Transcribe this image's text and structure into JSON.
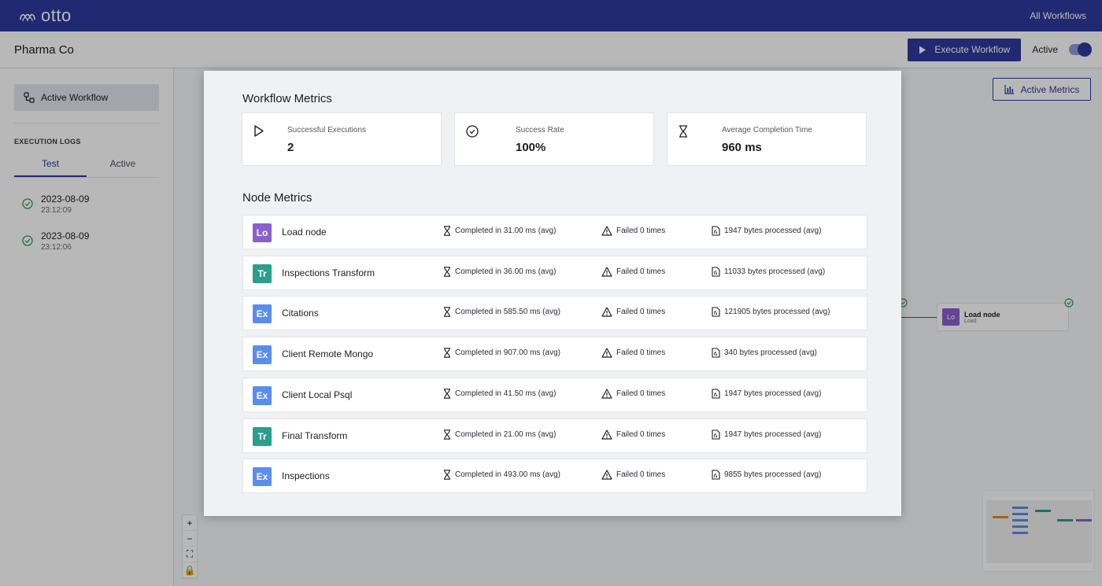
{
  "app": {
    "brand": "otto",
    "all_workflows_link": "All Workflows"
  },
  "header": {
    "org_name": "Pharma Co",
    "execute_button": "Execute Workflow",
    "active_label": "Active",
    "active_toggle_on": true
  },
  "sidebar": {
    "active_workflow": "Active Workflow",
    "logs_title": "EXECUTION LOGS",
    "tabs": [
      "Test",
      "Active"
    ],
    "selected_tab": "Test",
    "logs": [
      {
        "date": "2023-08-09",
        "time": "23:12:09"
      },
      {
        "date": "2023-08-09",
        "time": "23:12:06"
      }
    ]
  },
  "canvas": {
    "metrics_button": "Active Metrics",
    "visible_node": {
      "badge": "Lo",
      "title": "Load node",
      "subtitle": "Load"
    },
    "zoom_controls": [
      "+",
      "−",
      "⛶",
      "🔒"
    ]
  },
  "modal": {
    "title": "Workflow Metrics",
    "kpis": [
      {
        "label": "Successful Executions",
        "value": "2",
        "icon": "play-icon"
      },
      {
        "label": "Success Rate",
        "value": "100%",
        "icon": "check-circle-icon"
      },
      {
        "label": "Average Completion Time",
        "value": "960 ms",
        "icon": "hourglass-icon"
      }
    ],
    "node_metrics_title": "Node Metrics",
    "nodes": [
      {
        "badge": "Lo",
        "name": "Load node",
        "completed": "Completed in 31.00 ms (avg)",
        "failed": "Failed 0 times",
        "bytes": "1947 bytes processed (avg)"
      },
      {
        "badge": "Tr",
        "name": "Inspections Transform",
        "completed": "Completed in 36.00 ms (avg)",
        "failed": "Failed 0 times",
        "bytes": "11033 bytes processed (avg)"
      },
      {
        "badge": "Ex",
        "name": "Citations",
        "completed": "Completed in 585.50 ms (avg)",
        "failed": "Failed 0 times",
        "bytes": "121905 bytes processed (avg)"
      },
      {
        "badge": "Ex",
        "name": "Client Remote Mongo",
        "completed": "Completed in 907.00 ms (avg)",
        "failed": "Failed 0 times",
        "bytes": "340 bytes processed (avg)"
      },
      {
        "badge": "Ex",
        "name": "Client Local Psql",
        "completed": "Completed in 41.50 ms (avg)",
        "failed": "Failed 0 times",
        "bytes": "1947 bytes processed (avg)"
      },
      {
        "badge": "Tr",
        "name": "Final Transform",
        "completed": "Completed in 21.00 ms (avg)",
        "failed": "Failed 0 times",
        "bytes": "1947 bytes processed (avg)"
      },
      {
        "badge": "Ex",
        "name": "Inspections",
        "completed": "Completed in 493.00 ms (avg)",
        "failed": "Failed 0 times",
        "bytes": "9855 bytes processed (avg)"
      }
    ]
  },
  "colors": {
    "primary": "#2f3a9e",
    "badge_load": "#8a5fcf",
    "badge_transform": "#2a9d8f",
    "badge_extract": "#5b8def",
    "success": "#2e9e5e"
  }
}
